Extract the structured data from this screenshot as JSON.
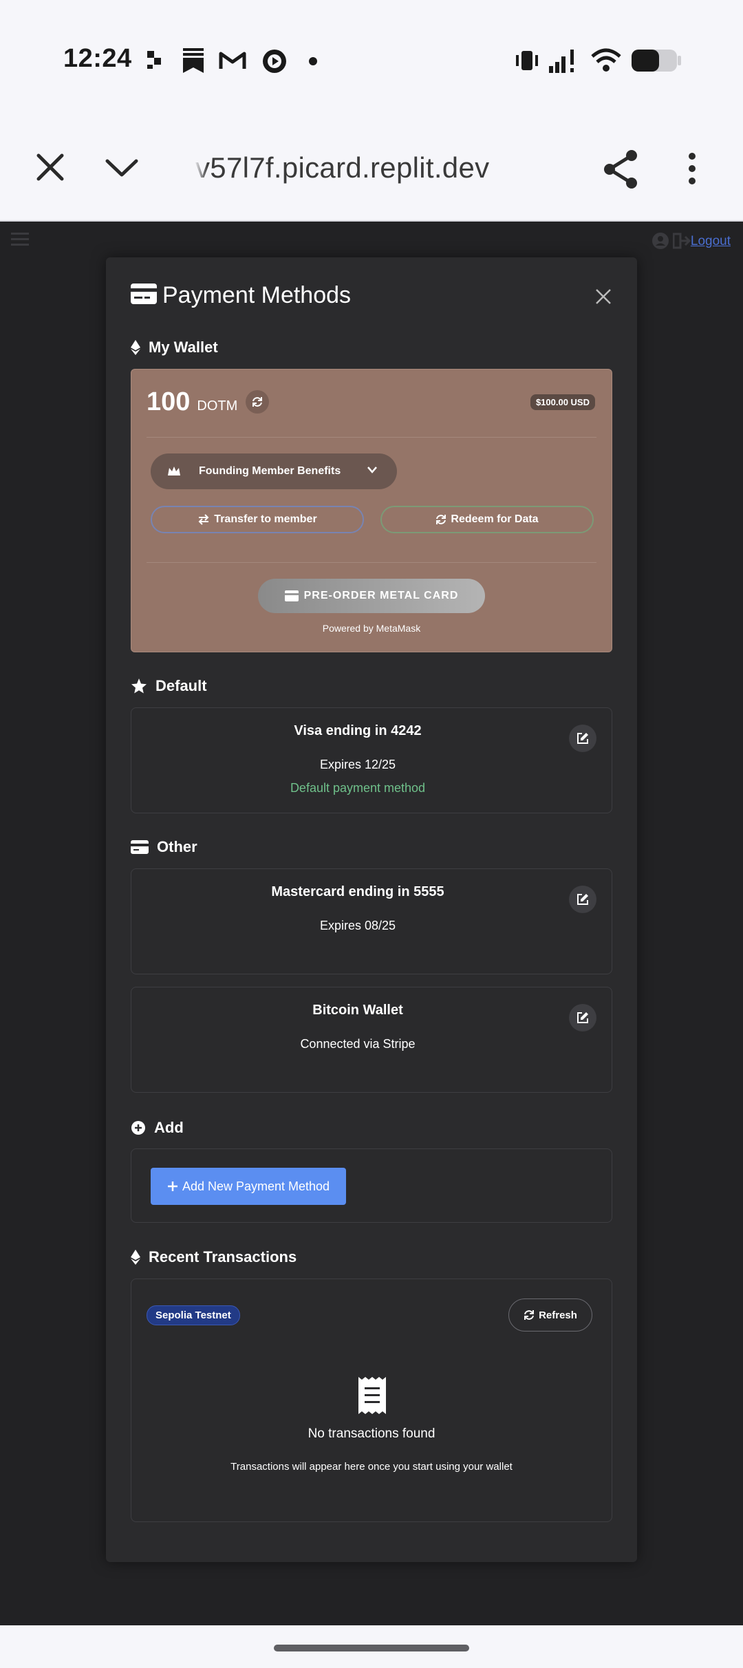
{
  "status_bar": {
    "time": "12:24"
  },
  "browser": {
    "url": "v57l7f.picard.replit.dev"
  },
  "page": {
    "logout_label": "Logout"
  },
  "modal": {
    "title": "Payment Methods",
    "wallet_section": "My Wallet",
    "wallet": {
      "balance": "100",
      "unit": "DOTM",
      "usd": "$100.00 USD",
      "benefits_label": "Founding Member Benefits",
      "transfer_label": "Transfer to member",
      "redeem_label": "Redeem for Data",
      "preorder_label": "PRE-ORDER METAL CARD",
      "powered_by": "Powered by MetaMask"
    },
    "default_section": "Default",
    "default_card": {
      "title": "Visa ending in 4242",
      "expires": "Expires 12/25",
      "default_text": "Default payment method"
    },
    "other_section": "Other",
    "other_cards": [
      {
        "title": "Mastercard ending in 5555",
        "sub": "Expires 08/25"
      },
      {
        "title": "Bitcoin Wallet",
        "sub": "Connected via Stripe"
      }
    ],
    "add_section": "Add",
    "add_button": "Add New Payment Method",
    "tx_section": "Recent Transactions",
    "tx": {
      "network": "Sepolia Testnet",
      "refresh_label": "Refresh",
      "empty": "No transactions found",
      "note": "Transactions will appear here once you start using your wallet"
    }
  },
  "colors": {
    "accent": "#5b8ef1",
    "wallet_bg": "#957568",
    "success": "#6fc08a",
    "network_badge": "#223a86"
  }
}
